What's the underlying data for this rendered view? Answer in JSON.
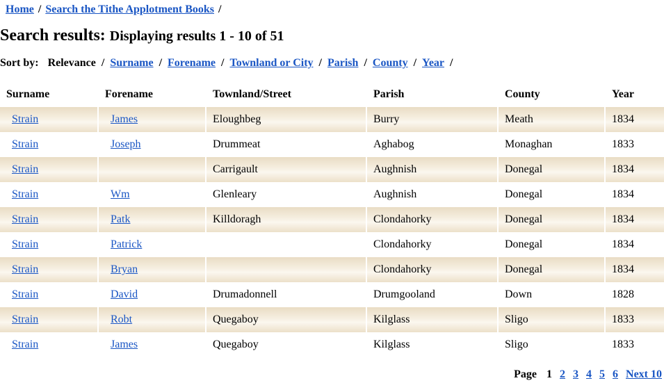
{
  "breadcrumb": {
    "home": "Home",
    "separator": "/",
    "section": "Search the Tithe Applotment Books",
    "trailing": "/"
  },
  "heading": {
    "title": "Search results:",
    "subtitle": "Displaying results 1 - 10 of 51"
  },
  "sort": {
    "label": "Sort by:",
    "current": "Relevance",
    "separator": "/",
    "options": [
      "Surname",
      "Forename",
      "Townland or City",
      "Parish",
      "County",
      "Year"
    ]
  },
  "table": {
    "headers": [
      "Surname",
      "Forename",
      "Townland/Street",
      "Parish",
      "County",
      "Year"
    ],
    "rows": [
      {
        "surname": "Strain",
        "forename": "James",
        "townland": "Eloughbeg",
        "parish": "Burry",
        "county": "Meath",
        "year": "1834"
      },
      {
        "surname": "Strain",
        "forename": "Joseph",
        "townland": "Drummeat",
        "parish": "Aghabog",
        "county": "Monaghan",
        "year": "1833"
      },
      {
        "surname": "Strain",
        "forename": "",
        "townland": "Carrigault",
        "parish": "Aughnish",
        "county": "Donegal",
        "year": "1834"
      },
      {
        "surname": "Strain",
        "forename": "Wm",
        "townland": "Glenleary",
        "parish": "Aughnish",
        "county": "Donegal",
        "year": "1834"
      },
      {
        "surname": "Strain",
        "forename": "Patk",
        "townland": "Killdoragh",
        "parish": "Clondahorky",
        "county": "Donegal",
        "year": "1834"
      },
      {
        "surname": "Strain",
        "forename": "Patrick",
        "townland": "",
        "parish": "Clondahorky",
        "county": "Donegal",
        "year": "1834"
      },
      {
        "surname": "Strain",
        "forename": "Bryan",
        "townland": "",
        "parish": "Clondahorky",
        "county": "Donegal",
        "year": "1834"
      },
      {
        "surname": "Strain",
        "forename": "David",
        "townland": "Drumadonnell",
        "parish": "Drumgooland",
        "county": "Down",
        "year": "1828"
      },
      {
        "surname": "Strain",
        "forename": "Robt",
        "townland": "Quegaboy",
        "parish": "Kilglass",
        "county": "Sligo",
        "year": "1833"
      },
      {
        "surname": "Strain",
        "forename": "James",
        "townland": "Quegaboy",
        "parish": "Kilglass",
        "county": "Sligo",
        "year": "1833"
      }
    ]
  },
  "pager": {
    "label": "Page",
    "current": "1",
    "pages": [
      "2",
      "3",
      "4",
      "5",
      "6"
    ],
    "next": "Next 10"
  },
  "colors": {
    "link": "#1a56c4",
    "row_band": "#efe4cf"
  }
}
